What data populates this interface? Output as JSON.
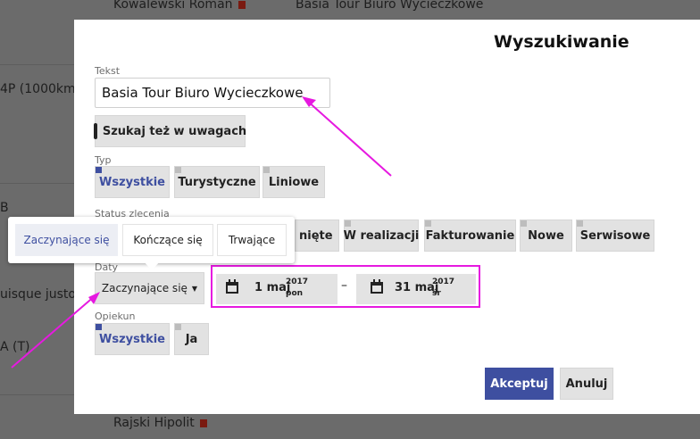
{
  "background": {
    "rows": [
      {
        "text": "Kowalewski Roman",
        "flag": true
      },
      {
        "text": "Basia Tour Biuro Wycieczkowe"
      },
      {
        "text": "4P (1000km"
      },
      {
        "text": "B"
      },
      {
        "text": "uisque justo"
      },
      {
        "text": "A (T)"
      },
      {
        "text": "Rajski Hipolit",
        "flag": true
      }
    ]
  },
  "modal": {
    "title": "Wyszukiwanie",
    "text_label": "Tekst",
    "text_value": "Basia Tour Biuro Wycieczkowe",
    "notes_checkbox_label": "Szukaj też w uwagach",
    "type_label": "Typ",
    "type_options": [
      "Wszystkie",
      "Turystyczne",
      "Liniowe"
    ],
    "status_label": "Status zlecenia",
    "status_options": [
      "nięte",
      "W realizacji",
      "Fakturowanie",
      "Nowe",
      "Serwisowe"
    ],
    "dates_label": "Daty",
    "dates_mode": "Zaczynające się",
    "date_from": {
      "day_month": "1 maj",
      "year": "2017",
      "weekday": "pon"
    },
    "date_separator": "–",
    "date_to": {
      "day_month": "31 maj",
      "year": "2017",
      "weekday": "śr"
    },
    "guardian_label": "Opiekun",
    "guardian_options": [
      "Wszystkie",
      "Ja"
    ],
    "accept_label": "Akceptuj",
    "cancel_label": "Anuluj"
  },
  "dates_popover": {
    "options": [
      "Zaczynające się",
      "Kończące się",
      "Trwające"
    ]
  },
  "colors": {
    "accent": "#3e4fa0",
    "annotation": "#e619e0",
    "overlay": "#6b6b6b"
  },
  "icons": {
    "calendar": "calendar-icon",
    "dropdown": "caret-down-icon"
  }
}
